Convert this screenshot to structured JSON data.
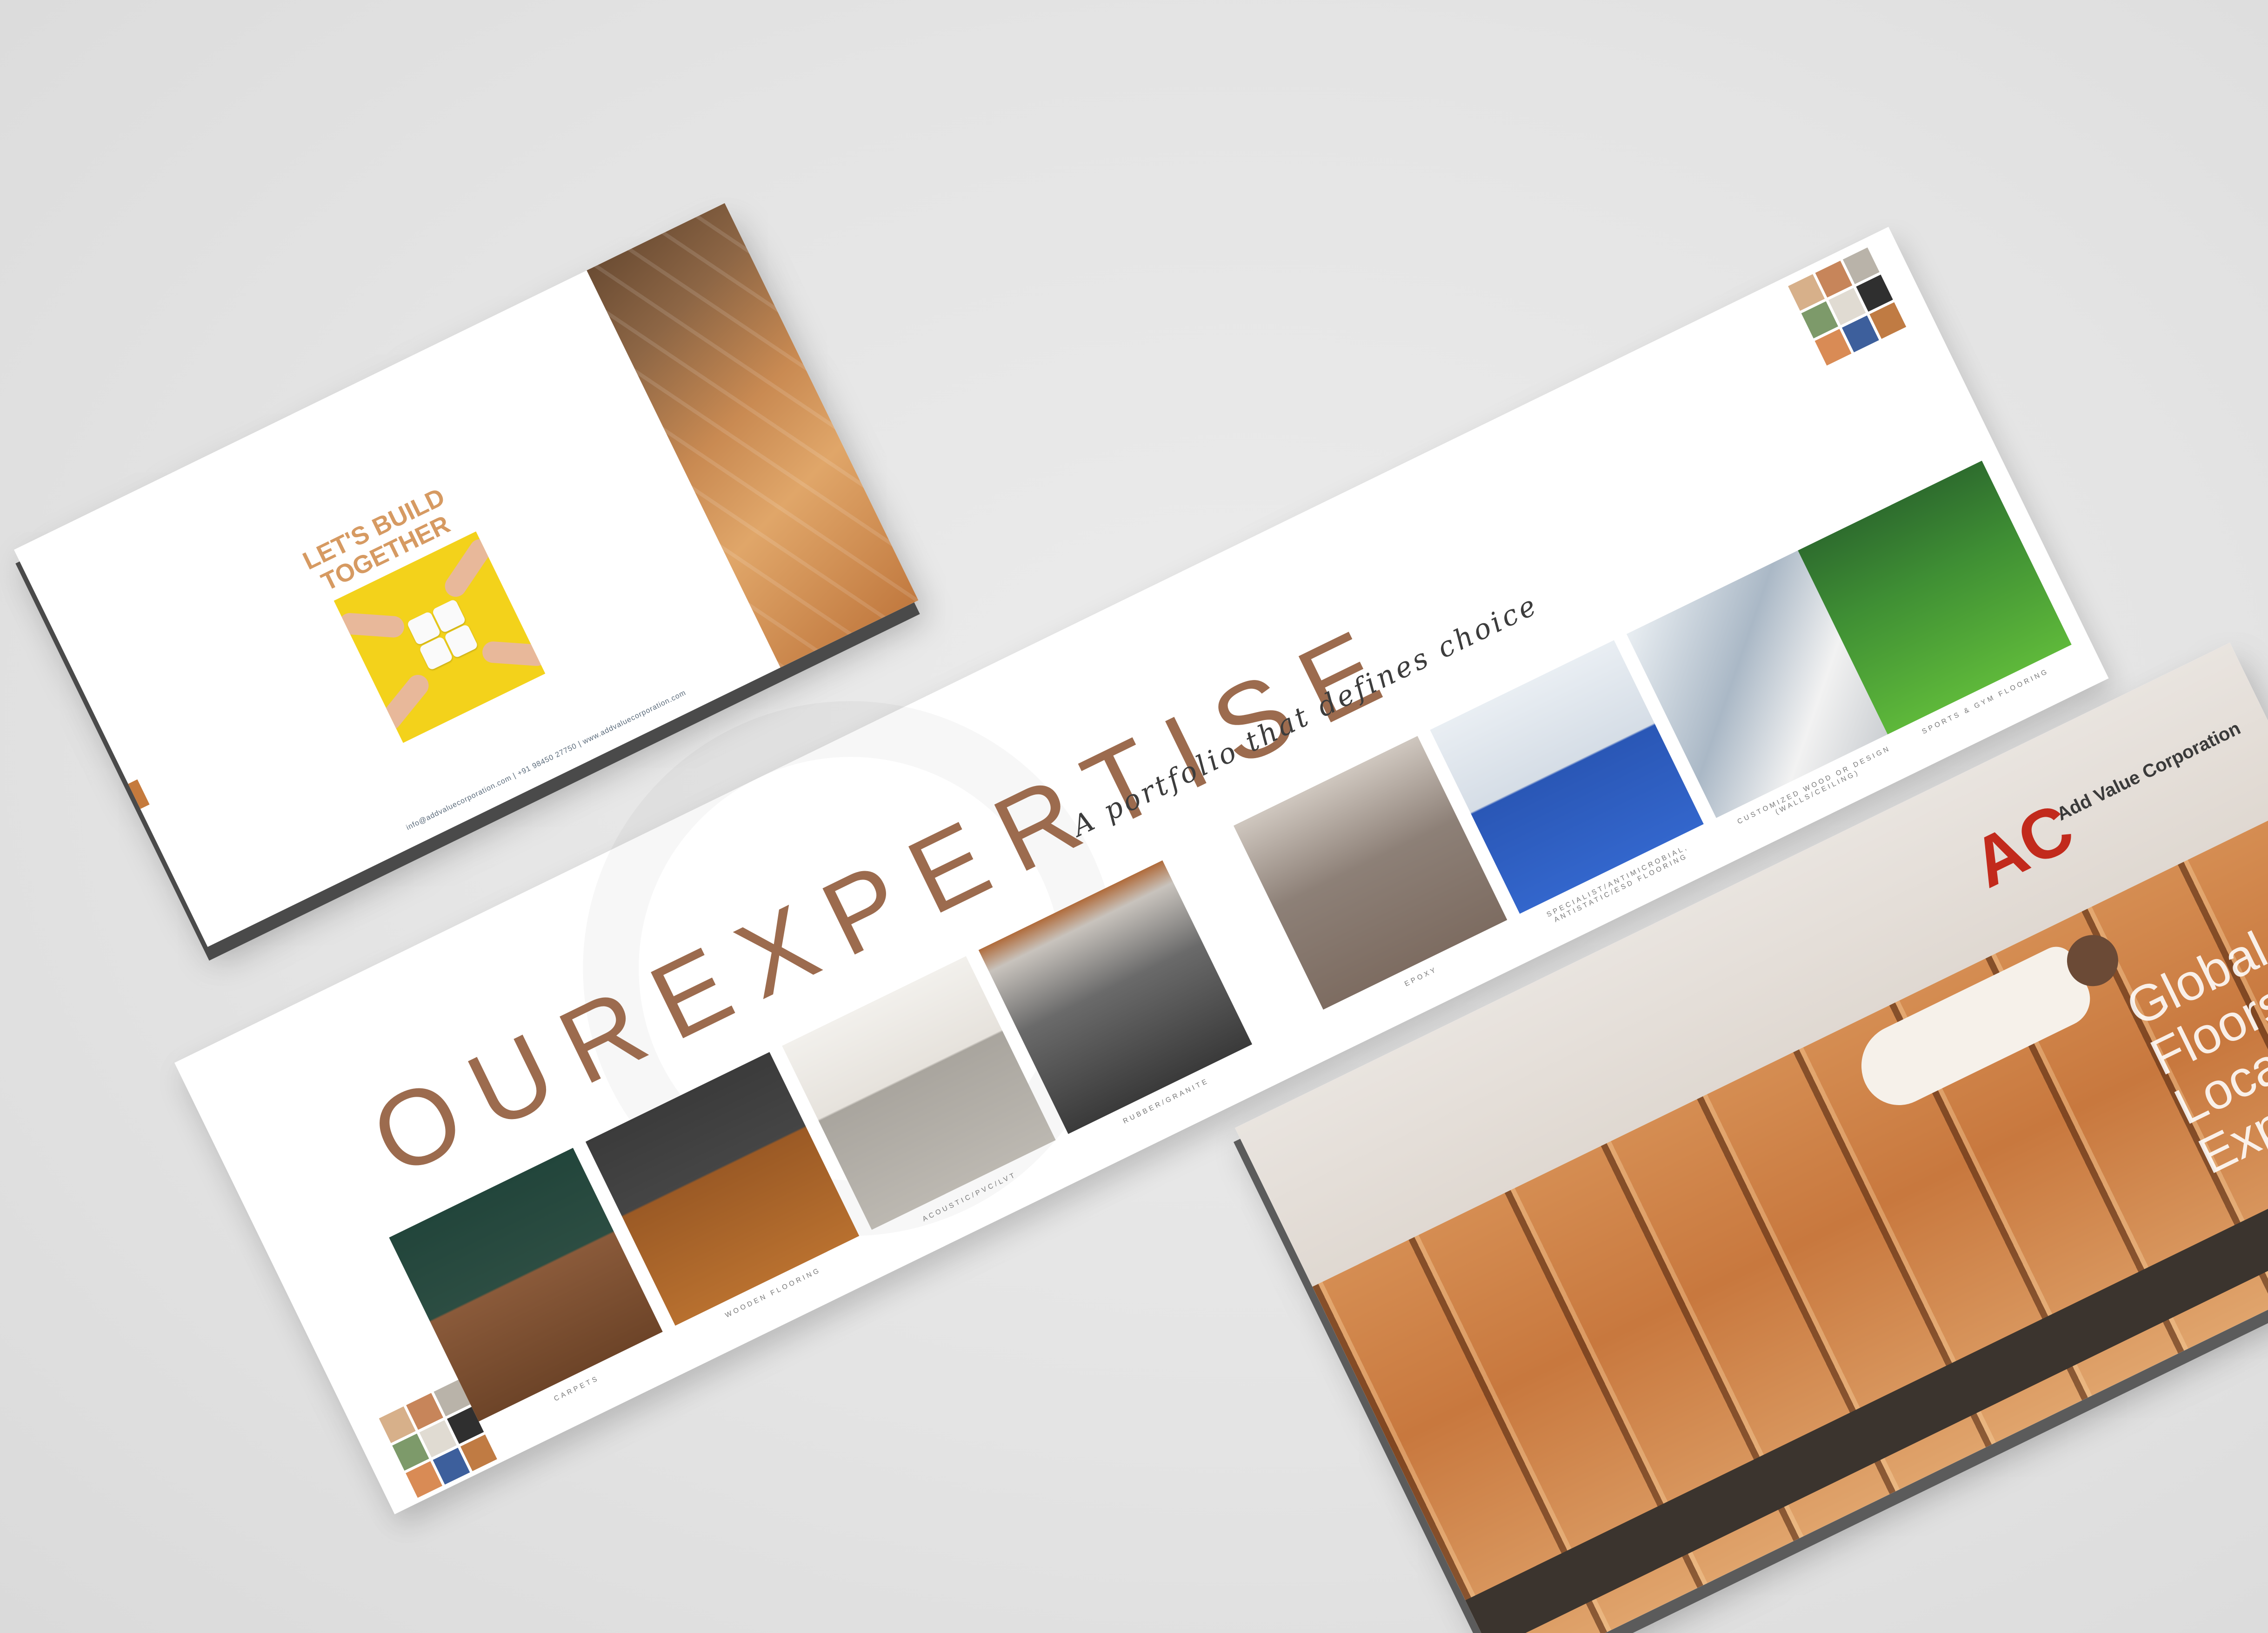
{
  "left_brochure": {
    "headline_line1": "LET'S BUILD",
    "headline_line2": "TOGETHER",
    "contact_line": "info@addvaluecorporation.com | +91 98450 27750 | www.addvaluecorporation.com"
  },
  "center_spread": {
    "title": "OUREXPERTISE",
    "subtitle": "A portfolio that defines choice",
    "captions": [
      "CARPETS",
      "WOODEN FLOORING",
      "ACOUSTIC/PVC/LVT",
      "RUBBER/GRANITE",
      "EPOXY",
      "SPECIALIST/ANTIMICROBIAL, ANTISTATIC/ESD FLOORING",
      "CUSTOMIZED WOOD OR DESIGN (WALLS/CEILING)",
      "SPORTS & GYM FLOORING"
    ]
  },
  "right_brochure": {
    "logo_letters": "AC",
    "company_name": "Add Value Corporation",
    "tagline_line1": "Global Floors.",
    "tagline_line2": "Local Expertise."
  },
  "colors": {
    "background": "#e3e3e3",
    "accent_brown": "#9c6b4e",
    "headline_tan": "#d69a62",
    "logo_red": "#c22a1c",
    "logo_orange": "#d98a2b",
    "puzzle_yellow": "#f3d21b"
  }
}
